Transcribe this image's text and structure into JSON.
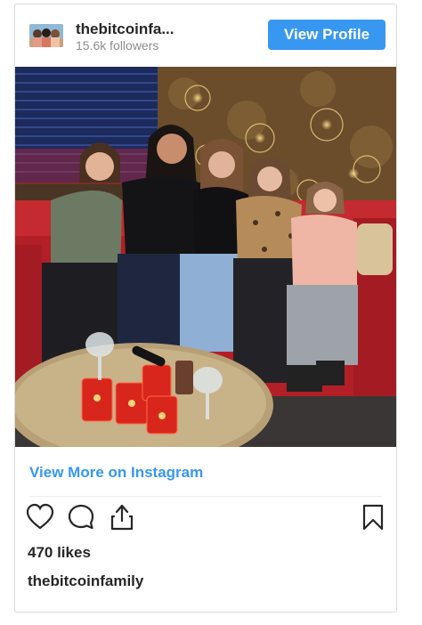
{
  "header": {
    "username": "thebitcoinfa...",
    "followers": "15.6k followers",
    "view_profile_label": "View Profile"
  },
  "post": {
    "view_more_label": "View More on Instagram",
    "likes": "470 likes",
    "caption_username": "thebitcoinfamily"
  },
  "icons": {
    "like": "heart-icon",
    "comment": "comment-icon",
    "share": "share-icon",
    "save": "bookmark-icon"
  },
  "colors": {
    "accent": "#3897f0",
    "text": "#262626",
    "muted": "#8e8e8e",
    "border": "#dbdbdb"
  }
}
